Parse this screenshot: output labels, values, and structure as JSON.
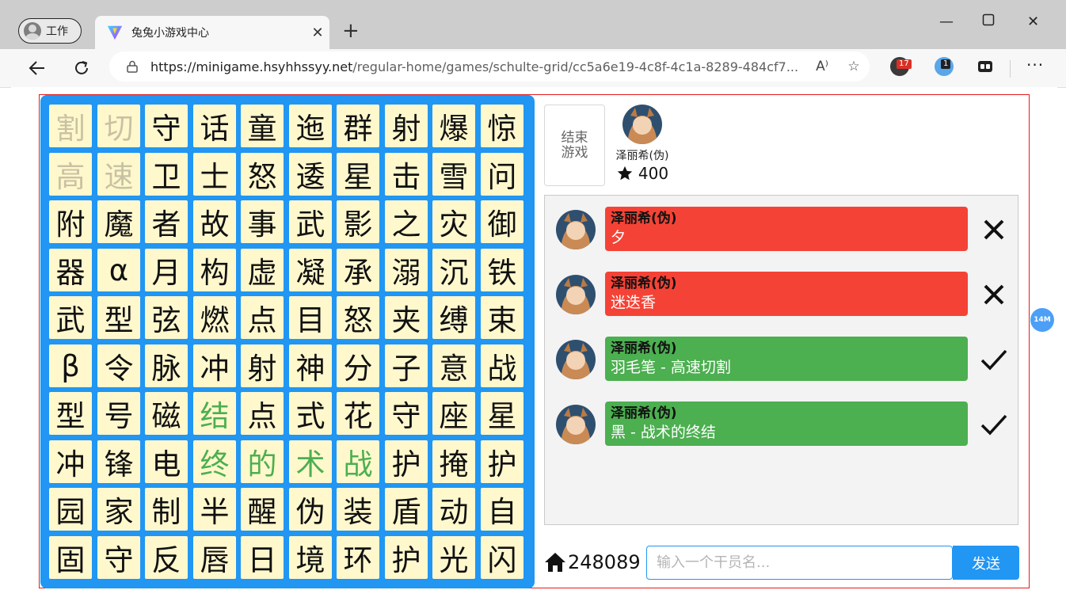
{
  "browser": {
    "profile_label": "工作",
    "tab_title": "兔兔小游戏中心",
    "url_host": "https://minigame.hsyhhssyy.net",
    "url_path": "/regular-home/games/schulte-grid/cc5a6e19-4c8f-4c1a-8289-484cf7...",
    "extensions": [
      {
        "icon": "extension-a-icon",
        "badge": "17",
        "badge_color": "#d93025"
      },
      {
        "icon": "extension-b-icon",
        "badge": "1",
        "badge_color": "#202124"
      }
    ]
  },
  "grid": {
    "rows": [
      [
        "割",
        "切",
        "守",
        "话",
        "童",
        "迤",
        "群",
        "射",
        "爆",
        "惊"
      ],
      [
        "高",
        "速",
        "卫",
        "士",
        "怒",
        "逶",
        "星",
        "击",
        "雪",
        "问"
      ],
      [
        "附",
        "魔",
        "者",
        "故",
        "事",
        "武",
        "影",
        "之",
        "灾",
        "御"
      ],
      [
        "器",
        "α",
        "月",
        "构",
        "虚",
        "凝",
        "承",
        "溺",
        "沉",
        "铁"
      ],
      [
        "武",
        "型",
        "弦",
        "燃",
        "点",
        "目",
        "怒",
        "夹",
        "缚",
        "束"
      ],
      [
        "β",
        "令",
        "脉",
        "冲",
        "射",
        "神",
        "分",
        "子",
        "意",
        "战"
      ],
      [
        "型",
        "号",
        "磁",
        "结",
        "点",
        "式",
        "花",
        "守",
        "座",
        "星"
      ],
      [
        "冲",
        "锋",
        "电",
        "终",
        "的",
        "术",
        "战",
        "护",
        "掩",
        "护"
      ],
      [
        "园",
        "家",
        "制",
        "半",
        "醒",
        "伪",
        "装",
        "盾",
        "动",
        "自"
      ],
      [
        "固",
        "守",
        "反",
        "唇",
        "日",
        "境",
        "环",
        "护",
        "光",
        "闪"
      ]
    ],
    "used_cells": [
      [
        0,
        0
      ],
      [
        0,
        1
      ],
      [
        1,
        0
      ],
      [
        1,
        1
      ]
    ],
    "match_cells": [
      [
        6,
        3
      ],
      [
        7,
        3
      ],
      [
        7,
        4
      ],
      [
        7,
        5
      ],
      [
        7,
        6
      ]
    ],
    "colors": {
      "cell_bg": "#fff8cd",
      "panel_bg": "#2196f3",
      "used_text": "#c8c2a3",
      "match_text": "#4caf50"
    }
  },
  "controls": {
    "end_game_label": "结束游戏"
  },
  "player": {
    "name": "泽丽希(伪)",
    "score": "400"
  },
  "chat": {
    "messages": [
      {
        "sender": "泽丽希(伪)",
        "text": "夕",
        "correct": false
      },
      {
        "sender": "泽丽希(伪)",
        "text": "迷迭香",
        "correct": false
      },
      {
        "sender": "泽丽希(伪)",
        "text": "羽毛笔 - 高速切割",
        "correct": true
      },
      {
        "sender": "泽丽希(伪)",
        "text": "黑 - 战术的终结",
        "correct": true
      }
    ],
    "colors": {
      "wrong": "#f44336",
      "right": "#4caf50"
    }
  },
  "room": {
    "code": "248089"
  },
  "input": {
    "placeholder": "输入一个干员名...",
    "send_label": "发送"
  },
  "floating_badge": "14M"
}
